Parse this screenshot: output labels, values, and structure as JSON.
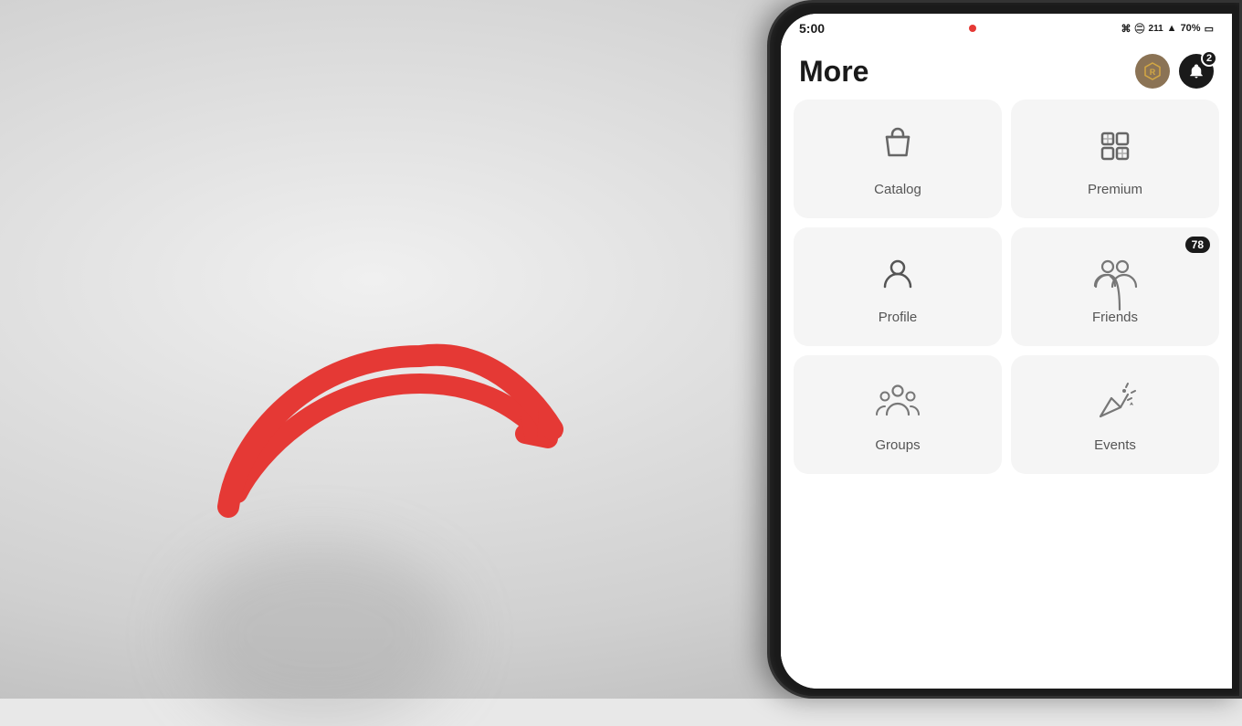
{
  "background": {
    "color": "#e0e0e0"
  },
  "status_bar": {
    "time": "5:00",
    "battery": "70%",
    "icons": [
      "bluetooth",
      "wifi",
      "data",
      "signal",
      "battery"
    ]
  },
  "header": {
    "title": "More",
    "notification_badge": "2"
  },
  "menu_items": [
    {
      "id": "catalog",
      "label": "Catalog",
      "icon": "shopping-bag",
      "badge": null,
      "row": 0,
      "col": 0
    },
    {
      "id": "premium",
      "label": "Premium",
      "icon": "premium-grid",
      "badge": null,
      "row": 0,
      "col": 1
    },
    {
      "id": "profile",
      "label": "Profile",
      "icon": "person",
      "badge": null,
      "row": 1,
      "col": 0
    },
    {
      "id": "friends",
      "label": "Friends",
      "icon": "people",
      "badge": "78",
      "row": 1,
      "col": 1
    },
    {
      "id": "groups",
      "label": "Groups",
      "icon": "groups",
      "badge": null,
      "row": 2,
      "col": 0
    },
    {
      "id": "events",
      "label": "Events",
      "icon": "party",
      "badge": null,
      "row": 2,
      "col": 1
    }
  ],
  "arrow": {
    "color": "#e53935",
    "points_to": "profile"
  }
}
